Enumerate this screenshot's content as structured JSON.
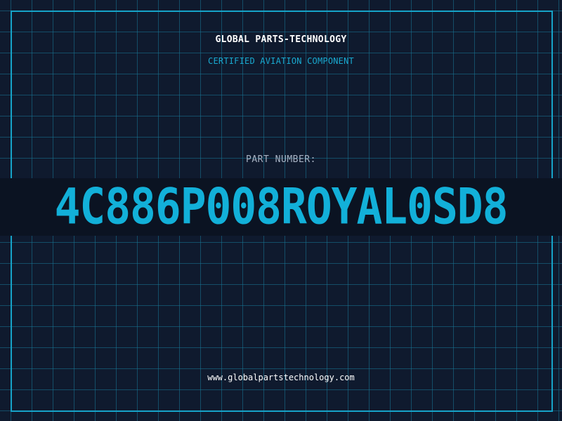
{
  "header": {
    "company": "GLOBAL PARTS-TECHNOLOGY",
    "tagline": "CERTIFIED AVIATION COMPONENT"
  },
  "part": {
    "label": "PART NUMBER:",
    "number": "4C886P008ROYAL0SD8"
  },
  "footer": {
    "website": "www.globalpartstechnology.com"
  },
  "colors": {
    "background": "#0f1a2e",
    "grid": "#187696",
    "accent": "#16a3c8",
    "band": "#0b1322"
  }
}
